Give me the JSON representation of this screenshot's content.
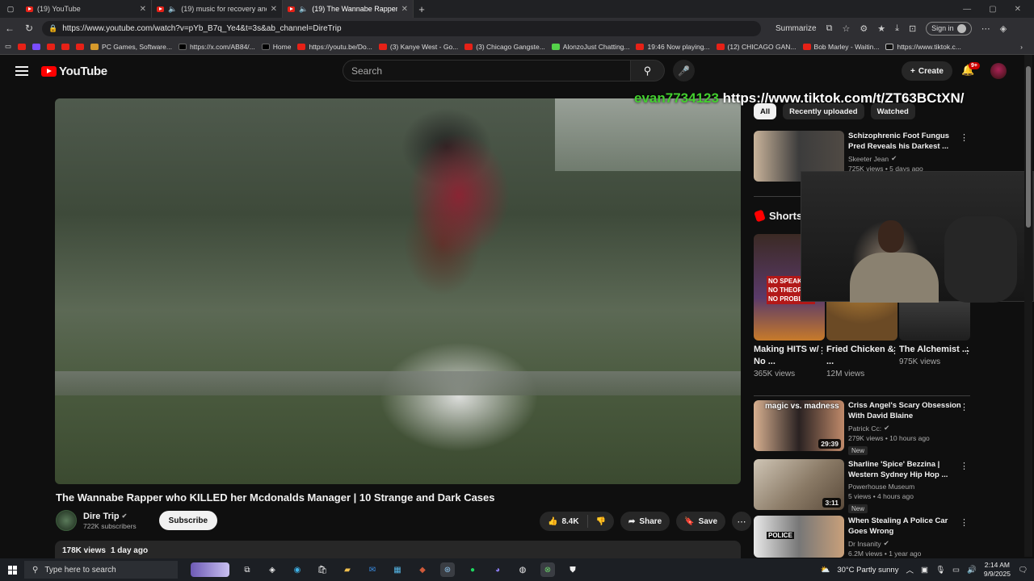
{
  "browser": {
    "tabs": [
      {
        "title": "(19) YouTube"
      },
      {
        "title": "(19) music for recovery and"
      },
      {
        "title": "(19) The Wannabe Rapper w"
      }
    ],
    "url": "https://www.youtube.com/watch?v=pYb_B7q_Ye4&t=3s&ab_channel=DireTrip",
    "summarize_label": "Summarize",
    "signin_label": "Sign in",
    "bookmarks": [
      "PC Games, Software...",
      "https://x.com/AB84/...",
      "Home",
      "https://youtu.be/Do...",
      "(3) Kanye West - Go...",
      "(3) Chicago Gangste...",
      "AlonzoJust Chatting...",
      "19:46 Now playing...",
      "(12) CHICAGO GAN...",
      "Bob Marley - Waitin...",
      "https://www.tiktok.c..."
    ]
  },
  "youtube": {
    "logo_text": "YouTube",
    "search_placeholder": "Search",
    "create_label": "Create",
    "notification_count": "9+",
    "overlay": {
      "user": "evan7734123",
      "link": "https://www.tiktok.com/t/ZT63BCtXN/"
    },
    "video": {
      "title": "The Wannabe Rapper who KILLED her Mcdonalds Manager | 10 Strange and Dark Cases",
      "channel": "Dire Trip",
      "subscribers": "722K subscribers",
      "subscribe_label": "Subscribe",
      "likes": "8.4K",
      "share_label": "Share",
      "save_label": "Save",
      "views": "178K views",
      "age": "1 day ago"
    },
    "chips": [
      "All",
      "Recently uploaded",
      "Watched"
    ],
    "shorts_label": "Shorts",
    "recommended_top": {
      "title": "Schizophrenic Foot Fungus Pred Reveals his Darkest ...",
      "channel": "Skeeter Jean",
      "stats": "725K views • 5 days ago"
    },
    "shorts": [
      {
        "title": "Making HITS w/ No ...",
        "views": "365K views",
        "thumb_text": "NO SPEAKE... NO THEOR... NO PROBL..."
      },
      {
        "title": "Fried Chicken & ...",
        "views": "12M views"
      },
      {
        "title": "The Alchemist ...",
        "views": "975K views"
      }
    ],
    "recommended": [
      {
        "title": "Criss Angel's Scary Obsession With David Blaine",
        "channel": "Patrick Cc:",
        "stats": "279K views • 10 hours ago",
        "duration": "29:39",
        "badge": "New",
        "thumb_text": "magic vs. madness"
      },
      {
        "title": "Sharline 'Spice' Bezzina | Western Sydney Hip Hop ...",
        "channel": "Powerhouse Museum",
        "stats": "5 views • 4 hours ago",
        "duration": "3:11",
        "badge": "New"
      },
      {
        "title": "When Stealing A Police Car Goes Wrong",
        "channel": "Dr Insanity",
        "stats": "6.2M views • 1 year ago",
        "thumb_text": "POLICE"
      }
    ]
  },
  "taskbar": {
    "search_placeholder": "Type here to search",
    "weather": "30°C  Partly sunny",
    "time": "2:14 AM",
    "date": "9/9/2025"
  }
}
